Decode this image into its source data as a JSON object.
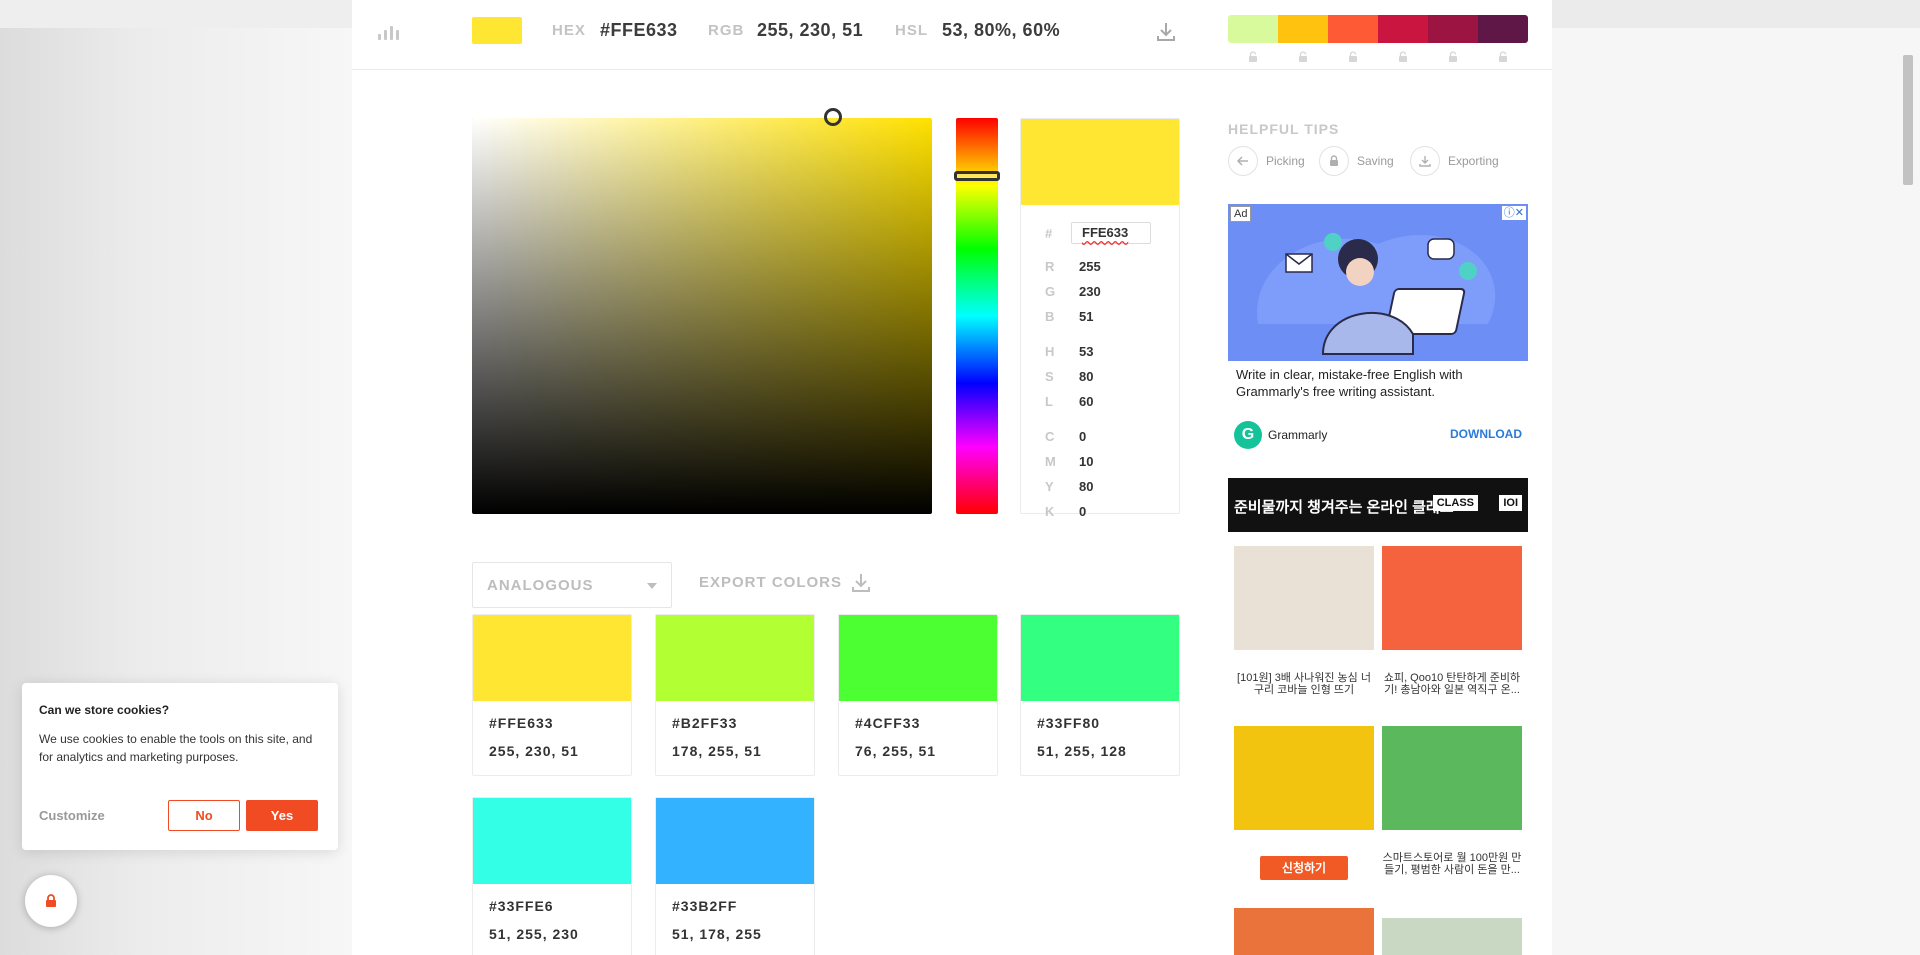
{
  "header": {
    "current_color": "#FFE633",
    "hex_label": "HEX",
    "hex_value": "#FFE633",
    "rgb_label": "RGB",
    "rgb_value": "255, 230, 51",
    "hsl_label": "HSL",
    "hsl_value": "53, 80%, 60%",
    "palette": [
      "#D9F99D",
      "#FFC20E",
      "#FF5A36",
      "#C9153F",
      "#9B1442",
      "#5F1747"
    ]
  },
  "picker": {
    "hue_color": "#FFE100",
    "preview_color": "#FFE633",
    "hex_prefix": "#",
    "hex_input": "FFE633",
    "rgb": [
      {
        "k": "R",
        "v": "255"
      },
      {
        "k": "G",
        "v": "230"
      },
      {
        "k": "B",
        "v": "51"
      }
    ],
    "hsl": [
      {
        "k": "H",
        "v": "53"
      },
      {
        "k": "S",
        "v": "80"
      },
      {
        "k": "L",
        "v": "60"
      }
    ],
    "cmyk": [
      {
        "k": "C",
        "v": "0"
      },
      {
        "k": "M",
        "v": "10"
      },
      {
        "k": "Y",
        "v": "80"
      },
      {
        "k": "K",
        "v": "0"
      }
    ]
  },
  "harmony": {
    "mode": "ANALOGOUS",
    "export_label": "EXPORT COLORS",
    "colors": [
      {
        "hex": "#FFE633",
        "rgb": "255, 230, 51"
      },
      {
        "hex": "#B2FF33",
        "rgb": "178, 255, 51"
      },
      {
        "hex": "#4CFF33",
        "rgb": "76, 255, 51"
      },
      {
        "hex": "#33FF80",
        "rgb": "51, 255, 128"
      },
      {
        "hex": "#33FFE6",
        "rgb": "51, 255, 230"
      },
      {
        "hex": "#33B2FF",
        "rgb": "51, 178, 255"
      }
    ]
  },
  "tips": {
    "title": "HELPFUL TIPS",
    "items": [
      "Picking",
      "Saving",
      "Exporting"
    ]
  },
  "ad_grammarly": {
    "badge": "Ad",
    "copy": "Write in clear, mistake-free English with Grammarly's free writing assistant.",
    "brand": "Grammarly",
    "brand_letter": "G",
    "cta": "DOWNLOAD"
  },
  "ad_korean": {
    "headline": "준비물까지 챙겨주는 온라인 클래스",
    "badge1": "CLASS",
    "badge2": "IOI",
    "tiles": [
      {
        "caption": "[101원] 3배 사나워진 농심 너구리 코바늘 인형 뜨기",
        "color": "#e9e1d6"
      },
      {
        "caption": "쇼피, Qoo10 탄탄하게 준비하기! 총남아와 일본 역직구 온...",
        "color": "#f4633d"
      },
      {
        "caption": "",
        "button": "신청하기",
        "color": "#f2c40f"
      },
      {
        "caption": "스마트스토어로 월 100만원 만들기, 평범한 사람이 돈을 만...",
        "color": "#5bb85c"
      }
    ]
  },
  "cookie": {
    "title": "Can we store cookies?",
    "body": "We use cookies to enable the tools on this site, and for analytics and marketing purposes.",
    "customize": "Customize",
    "no": "No",
    "yes": "Yes"
  }
}
